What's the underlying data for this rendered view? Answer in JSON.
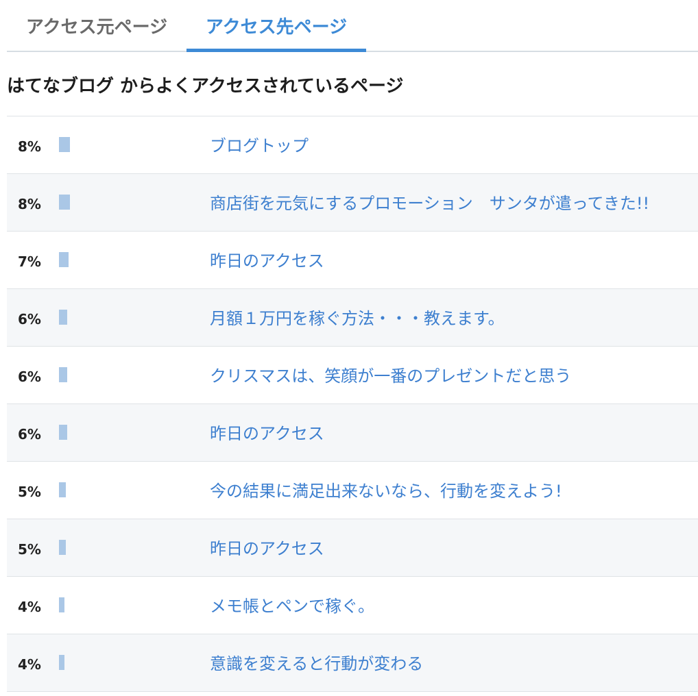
{
  "tabs": {
    "source_label": "アクセス元ページ",
    "target_label": "アクセス先ページ",
    "active": "target"
  },
  "section": {
    "heading": "はてなブログ からよくアクセスされているページ"
  },
  "colors": {
    "accent": "#3d8ad6",
    "link": "#3d7fcf",
    "bar": "#aac7e6",
    "row_alt_bg": "#f5f7f9"
  },
  "rows": [
    {
      "percent": "8%",
      "share": 0.08,
      "title": "ブログトップ"
    },
    {
      "percent": "8%",
      "share": 0.08,
      "title": "商店街を元気にするプロモーション　サンタが遣ってきた!!"
    },
    {
      "percent": "7%",
      "share": 0.07,
      "title": "昨日のアクセス"
    },
    {
      "percent": "6%",
      "share": 0.06,
      "title": "月額１万円を稼ぐ方法・・・教えます。"
    },
    {
      "percent": "6%",
      "share": 0.06,
      "title": "クリスマスは、笑顔が一番のプレゼントだと思う"
    },
    {
      "percent": "6%",
      "share": 0.06,
      "title": "昨日のアクセス"
    },
    {
      "percent": "5%",
      "share": 0.05,
      "title": "今の結果に満足出来ないなら、行動を変えよう!"
    },
    {
      "percent": "5%",
      "share": 0.05,
      "title": "昨日のアクセス"
    },
    {
      "percent": "4%",
      "share": 0.04,
      "title": "メモ帳とペンで稼ぐ。"
    },
    {
      "percent": "4%",
      "share": 0.04,
      "title": "意識を変えると行動が変わる"
    }
  ]
}
